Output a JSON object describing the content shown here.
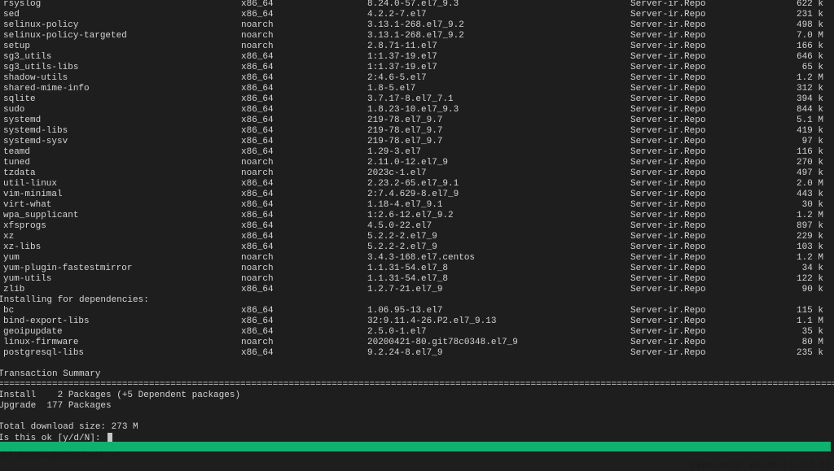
{
  "packages": [
    [
      "rsyslog",
      "x86_64",
      "8.24.0-57.el7_9.3",
      "Server-ir.Repo",
      "622 k"
    ],
    [
      "sed",
      "x86_64",
      "4.2.2-7.el7",
      "Server-ir.Repo",
      "231 k"
    ],
    [
      "selinux-policy",
      "noarch",
      "3.13.1-268.el7_9.2",
      "Server-ir.Repo",
      "498 k"
    ],
    [
      "selinux-policy-targeted",
      "noarch",
      "3.13.1-268.el7_9.2",
      "Server-ir.Repo",
      "7.0 M"
    ],
    [
      "setup",
      "noarch",
      "2.8.71-11.el7",
      "Server-ir.Repo",
      "166 k"
    ],
    [
      "sg3_utils",
      "x86_64",
      "1:1.37-19.el7",
      "Server-ir.Repo",
      "646 k"
    ],
    [
      "sg3_utils-libs",
      "x86_64",
      "1:1.37-19.el7",
      "Server-ir.Repo",
      "65 k"
    ],
    [
      "shadow-utils",
      "x86_64",
      "2:4.6-5.el7",
      "Server-ir.Repo",
      "1.2 M"
    ],
    [
      "shared-mime-info",
      "x86_64",
      "1.8-5.el7",
      "Server-ir.Repo",
      "312 k"
    ],
    [
      "sqlite",
      "x86_64",
      "3.7.17-8.el7_7.1",
      "Server-ir.Repo",
      "394 k"
    ],
    [
      "sudo",
      "x86_64",
      "1.8.23-10.el7_9.3",
      "Server-ir.Repo",
      "844 k"
    ],
    [
      "systemd",
      "x86_64",
      "219-78.el7_9.7",
      "Server-ir.Repo",
      "5.1 M"
    ],
    [
      "systemd-libs",
      "x86_64",
      "219-78.el7_9.7",
      "Server-ir.Repo",
      "419 k"
    ],
    [
      "systemd-sysv",
      "x86_64",
      "219-78.el7_9.7",
      "Server-ir.Repo",
      "97 k"
    ],
    [
      "teamd",
      "x86_64",
      "1.29-3.el7",
      "Server-ir.Repo",
      "116 k"
    ],
    [
      "tuned",
      "noarch",
      "2.11.0-12.el7_9",
      "Server-ir.Repo",
      "270 k"
    ],
    [
      "tzdata",
      "noarch",
      "2023c-1.el7",
      "Server-ir.Repo",
      "497 k"
    ],
    [
      "util-linux",
      "x86_64",
      "2.23.2-65.el7_9.1",
      "Server-ir.Repo",
      "2.0 M"
    ],
    [
      "vim-minimal",
      "x86_64",
      "2:7.4.629-8.el7_9",
      "Server-ir.Repo",
      "443 k"
    ],
    [
      "virt-what",
      "x86_64",
      "1.18-4.el7_9.1",
      "Server-ir.Repo",
      "30 k"
    ],
    [
      "wpa_supplicant",
      "x86_64",
      "1:2.6-12.el7_9.2",
      "Server-ir.Repo",
      "1.2 M"
    ],
    [
      "xfsprogs",
      "x86_64",
      "4.5.0-22.el7",
      "Server-ir.Repo",
      "897 k"
    ],
    [
      "xz",
      "x86_64",
      "5.2.2-2.el7_9",
      "Server-ir.Repo",
      "229 k"
    ],
    [
      "xz-libs",
      "x86_64",
      "5.2.2-2.el7_9",
      "Server-ir.Repo",
      "103 k"
    ],
    [
      "yum",
      "noarch",
      "3.4.3-168.el7.centos",
      "Server-ir.Repo",
      "1.2 M"
    ],
    [
      "yum-plugin-fastestmirror",
      "noarch",
      "1.1.31-54.el7_8",
      "Server-ir.Repo",
      "34 k"
    ],
    [
      "yum-utils",
      "noarch",
      "1.1.31-54.el7_8",
      "Server-ir.Repo",
      "122 k"
    ],
    [
      "zlib",
      "x86_64",
      "1.2.7-21.el7_9",
      "Server-ir.Repo",
      "90 k"
    ]
  ],
  "deps_header": "Installing for dependencies:",
  "dependencies": [
    [
      "bc",
      "x86_64",
      "1.06.95-13.el7",
      "Server-ir.Repo",
      "115 k"
    ],
    [
      "bind-export-libs",
      "x86_64",
      "32:9.11.4-26.P2.el7_9.13",
      "Server-ir.Repo",
      "1.1 M"
    ],
    [
      "geoipupdate",
      "x86_64",
      "2.5.0-1.el7",
      "Server-ir.Repo",
      "35 k"
    ],
    [
      "linux-firmware",
      "noarch",
      "20200421-80.git78c0348.el7_9",
      "Server-ir.Repo",
      "80 M"
    ],
    [
      "postgresql-libs",
      "x86_64",
      "9.2.24-8.el7_9",
      "Server-ir.Repo",
      "235 k"
    ]
  ],
  "summary": {
    "title": "Transaction Summary",
    "separator": "=======================================================================================================================================================================",
    "install": "Install    2 Packages (+5 Dependent packages)",
    "upgrade": "Upgrade  177 Packages",
    "total": "Total download size: 273 M",
    "prompt": "Is this ok [y/d/N]: "
  },
  "status_bar": {
    "left": "[0] 0:root@repo-test:~*",
    "right": "\"repo-test\" 06:18 12-Jul-23",
    "color": "#10b06e"
  }
}
